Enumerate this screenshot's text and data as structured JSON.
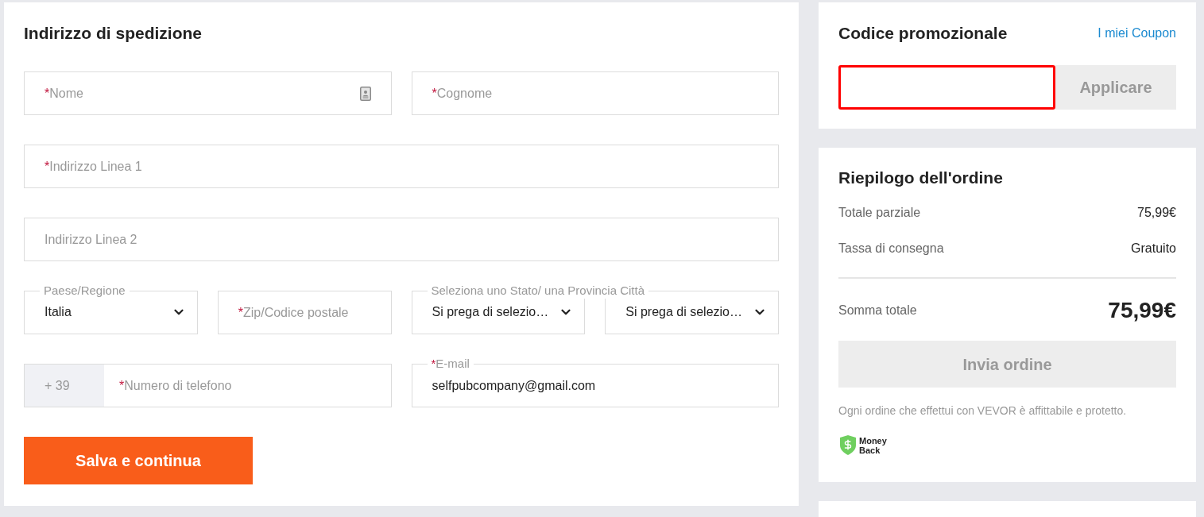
{
  "shipping": {
    "title": "Indirizzo di spedizione",
    "rows": [
      [
        {
          "kind": "text",
          "mark": "*",
          "placeholder": "Nome",
          "autofill_icon": true
        },
        {
          "kind": "text",
          "mark": "*",
          "placeholder": "Cognome"
        }
      ],
      [
        {
          "kind": "text",
          "mark": "*",
          "placeholder": "Indirizzo Linea 1"
        }
      ],
      [
        {
          "kind": "text",
          "placeholder": "Indirizzo Linea 2"
        }
      ],
      [
        {
          "kind": "select",
          "label": "Paese/Regione",
          "value": "Italia"
        },
        {
          "kind": "text",
          "mark": "*",
          "placeholder": "Zip/Codice postale"
        },
        {
          "kind": "select_pair",
          "label": "Seleziona uno Stato/ una Provincia Città",
          "values": [
            "Si prega di selezio…",
            "Si prega di selezio…"
          ]
        }
      ],
      [
        {
          "kind": "phone",
          "prefix": "+ 39",
          "mark": "*",
          "placeholder": "Numero di telefono"
        },
        {
          "kind": "labeled",
          "mark": "*",
          "label": "E-mail",
          "value": "selfpubcompany@gmail.com"
        }
      ]
    ],
    "submit": {
      "label": "Salva e continua"
    }
  },
  "promo": {
    "title": "Codice promozionale",
    "link": "I miei Coupon",
    "input": {
      "highlighted": true
    },
    "button": {
      "label": "Applicare",
      "disabled": true
    }
  },
  "summary": {
    "title": "Riepilogo dell'ordine",
    "lines": [
      {
        "label": "Totale parziale",
        "value": "75,99€"
      },
      {
        "label": "Tassa di consegna",
        "value": "Gratuito"
      }
    ],
    "total": {
      "label": "Somma totale",
      "value": "75,99€"
    },
    "button": {
      "label": "Invia ordine",
      "disabled": true
    },
    "note": "Ogni ordine che effettui con VEVOR è affittabile e protetto.",
    "badge": {
      "label": "Money Back"
    }
  }
}
